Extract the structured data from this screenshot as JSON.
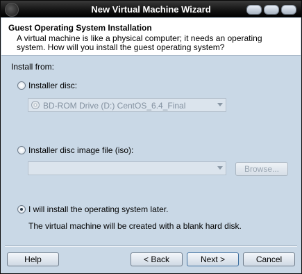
{
  "window": {
    "title": "New Virtual Machine Wizard"
  },
  "header": {
    "title": "Guest Operating System Installation",
    "description": "A virtual machine is like a physical computer; it needs an operating system. How will you install the guest operating system?"
  },
  "install_from_label": "Install from:",
  "options": {
    "installer_disc": {
      "label": "Installer disc:",
      "selected": false,
      "drive_value": "BD-ROM Drive (D:) CentOS_6.4_Final"
    },
    "iso": {
      "label": "Installer disc image file (iso):",
      "selected": false,
      "value": "",
      "browse_label": "Browse..."
    },
    "later": {
      "label": "I will install the operating system later.",
      "selected": true,
      "note": "The virtual machine will be created with a blank hard disk."
    }
  },
  "footer": {
    "help": "Help",
    "back": "< Back",
    "next": "Next >",
    "cancel": "Cancel"
  }
}
